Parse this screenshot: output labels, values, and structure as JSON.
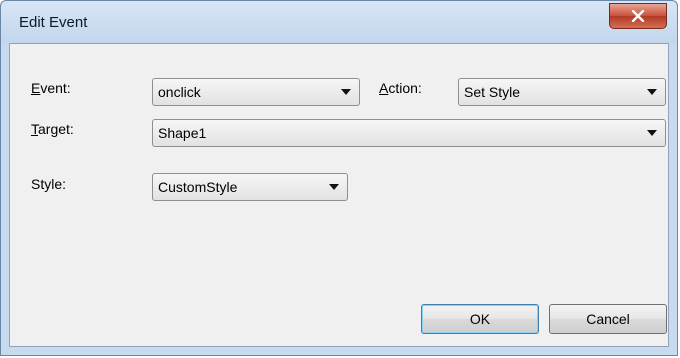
{
  "window": {
    "title": "Edit Event"
  },
  "fields": {
    "event": {
      "label_mnemonic": "E",
      "label_rest": "vent:",
      "value": "onclick"
    },
    "action": {
      "label_mnemonic": "A",
      "label_rest": "ction:",
      "value": "Set Style"
    },
    "target": {
      "label_mnemonic": "T",
      "label_rest": "arget:",
      "value": "Shape1"
    },
    "style": {
      "label": "Style:",
      "value": "CustomStyle"
    }
  },
  "buttons": {
    "ok": "OK",
    "cancel": "Cancel"
  },
  "icons": {
    "close": "close-icon",
    "dropdown": "chevron-down-icon"
  },
  "colors": {
    "close_button": "#c9503a",
    "client_bg": "#f0f0f0",
    "frame": "#c7daee"
  }
}
